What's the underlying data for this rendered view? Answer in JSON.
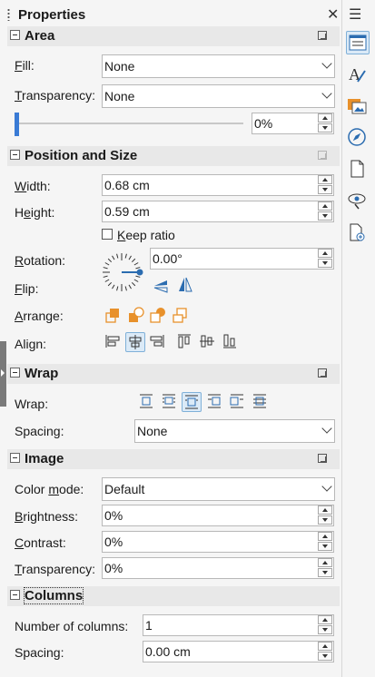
{
  "panel": {
    "title": "Properties",
    "close_icon": "close-icon",
    "menu_icon": "hamburger-menu-icon"
  },
  "area": {
    "title": "Area",
    "fill_label": "Fill:",
    "fill_value": "None",
    "transparency_label": "Transparency:",
    "transparency_value": "None",
    "slider_percent": "0%",
    "slider_level": 0
  },
  "position_size": {
    "title": "Position and Size",
    "width_label": "Width:",
    "width_value": "0.68 cm",
    "height_label": "Height:",
    "height_value": "0.59 cm",
    "keep_ratio_label": "Keep ratio",
    "keep_ratio_checked": false,
    "rotation_label": "Rotation:",
    "rotation_value": "0.00°",
    "flip_label": "Flip:",
    "arrange_label": "Arrange:",
    "align_label": "Align:"
  },
  "wrap": {
    "title": "Wrap",
    "wrap_label": "Wrap:",
    "spacing_label": "Spacing:",
    "spacing_value": "None"
  },
  "image": {
    "title": "Image",
    "color_mode_label": "Color mode:",
    "color_mode_value": "Default",
    "brightness_label": "Brightness:",
    "brightness_value": "0%",
    "contrast_label": "Contrast:",
    "contrast_value": "0%",
    "transparency_label": "Transparency:",
    "transparency_value": "0%"
  },
  "columns": {
    "title": "Columns",
    "number_label": "Number of columns:",
    "number_value": "1",
    "spacing_label": "Spacing:",
    "spacing_value": "0.00 cm"
  },
  "deck": {
    "icons": [
      "properties-icon",
      "styles-icon",
      "gallery-icon",
      "navigator-icon",
      "page-icon",
      "style-inspector-icon",
      "manage-changes-icon"
    ]
  },
  "colors": {
    "accent": "#3a7bd5",
    "icon_orange": "#e8912b",
    "icon_blue": "#2b6cb0"
  }
}
